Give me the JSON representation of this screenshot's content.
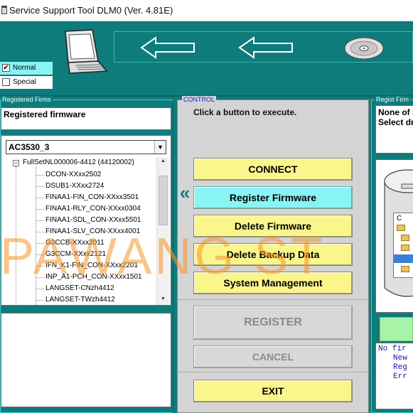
{
  "window": {
    "title": "Service Support Tool DLM0 (Ver. 4.81E)"
  },
  "mode": {
    "normal_label": "Normal",
    "special_label": "Special",
    "normal_checked": "✔"
  },
  "left_panel": {
    "group_label": "Registered Firms",
    "header_text": "Registered firmware",
    "select_value": "AC3530_3",
    "select_arrow": "▼",
    "tree_root": "FullSetNL000006-4412 (44120002)",
    "tree_items": [
      "DCON-XXxx2502",
      "DSUB1-XXxx2724",
      "FINAA1-FIN_CON-XXxx3501",
      "FINAA1-RLY_CON-XXxx0304",
      "FINAA1-SDL_CON-XXxx5501",
      "FINAA1-SLV_CON-XXxx4001",
      "G3CCB-XXxx2011",
      "G3CCM-XXxx2121",
      "IFN_K1-FIN_CON-XXxx2201",
      "INP_A1-PCH_CON-XXxx1501",
      "LANGSET-CNzh4412",
      "LANGSET-TWzh4412"
    ]
  },
  "control": {
    "group_label": "CONTROL",
    "instruction": "Click a button to execute.",
    "connect": "CONNECT",
    "register_firmware": "Register Firmware",
    "delete_firmware": "Delete Firmware",
    "delete_backup": "Delete Backup Data",
    "system_management": "System Management",
    "register": "REGISTER",
    "cancel": "CANCEL",
    "exit": "EXIT",
    "transfer_arrow": "«"
  },
  "right_panel": {
    "group_label": "Regist Firm",
    "line1": "None of i",
    "line2": "Select dr",
    "folder_letter": "C",
    "log_line1": "No fir",
    "log_line2": "New",
    "log_line3": "Reg",
    "log_line4": "Err"
  },
  "watermark": "PAWANG ST",
  "colors": {
    "background": "#0e7c7b",
    "button_yellow": "#fbf68c",
    "button_cyan": "#89f4f4",
    "button_disabled": "#d8d8d8",
    "accent_green": "#a7f3a7"
  }
}
